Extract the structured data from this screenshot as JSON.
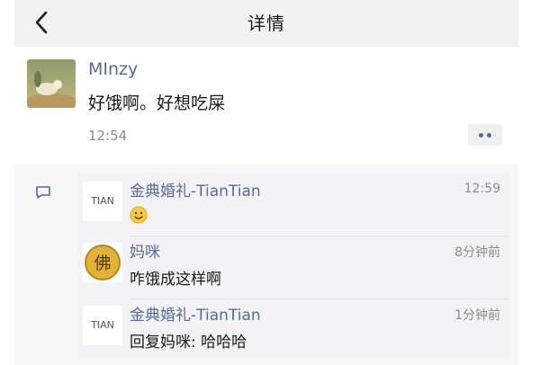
{
  "header": {
    "title": "详情"
  },
  "post": {
    "author": "MInzy",
    "text": "好饿啊。好想吃屎",
    "time": "12:54"
  },
  "comments": [
    {
      "author": "金典婚礼-TianTian",
      "avatar_text": "TIAN",
      "text": "",
      "emoji": "smile-emoji",
      "time": "12:59"
    },
    {
      "author": "妈咪",
      "avatar_text": "佛",
      "text": "咋饿成这样啊",
      "time": "8分钟前"
    },
    {
      "author": "金典婚礼-TianTian",
      "avatar_text": "TIAN",
      "text": "回复妈咪: 哈哈哈",
      "time": "1分钟前"
    }
  ],
  "colors": {
    "name_link": "#576b95",
    "header_bg": "#f2f2f2",
    "comments_bg": "#f3f3f5"
  }
}
